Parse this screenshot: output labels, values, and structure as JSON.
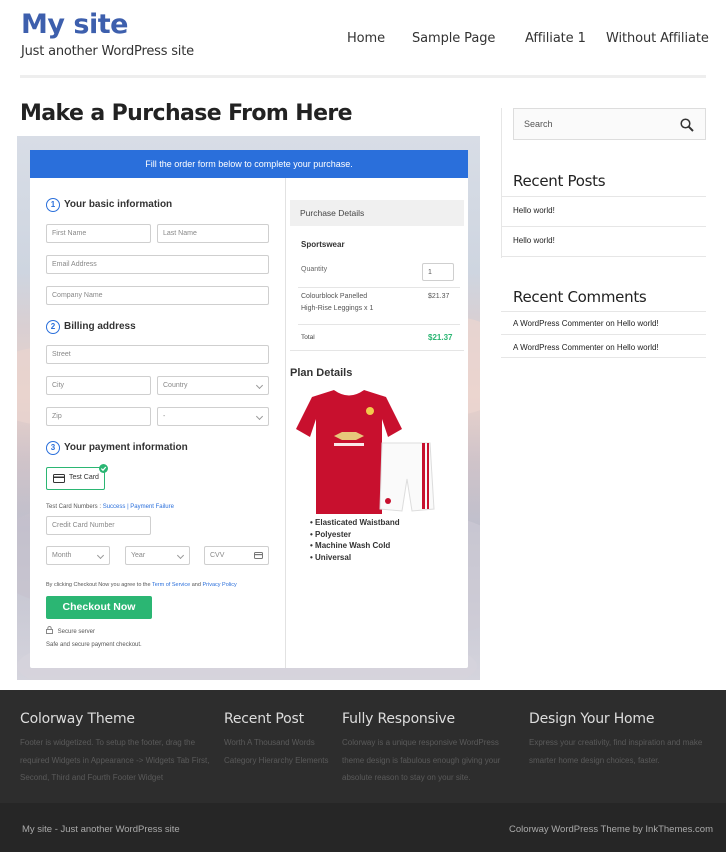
{
  "header": {
    "site_title": "My site",
    "tagline": "Just another WordPress site",
    "nav": [
      "Home",
      "Sample Page",
      "Affiliate 1",
      "Without Affiliate"
    ]
  },
  "page": {
    "title": "Make a Purchase From Here"
  },
  "form": {
    "banner": "Fill the order form below to complete your purchase.",
    "step1": {
      "num": "1",
      "title": "Your basic information"
    },
    "step2": {
      "num": "2",
      "title": "Billing address"
    },
    "step3": {
      "num": "3",
      "title": "Your payment information"
    },
    "first_name": "First Name",
    "last_name": "Last Name",
    "email": "Email Address",
    "company": "Company Name",
    "street": "Street",
    "city": "City",
    "country": "Country",
    "zip": "Zip",
    "state": "-",
    "test_card_label": "Test Card",
    "test_numbers_label": "Test Card Numbers :",
    "success": "Success",
    "sep": "|",
    "failure": "Payment Failure",
    "card_number": "Credit Card Number",
    "month": "Month",
    "year": "Year",
    "cvv": "CVV",
    "agree_prefix": "By clicking Checkout Now you agree to the",
    "terms": "Term of Service",
    "and": "and",
    "privacy": "Privacy Policy",
    "checkout": "Checkout Now",
    "secure": "Secure server",
    "safe": "Safe and secure payment checkout."
  },
  "purchase": {
    "heading": "Purchase Details",
    "product": "Sportswear",
    "quantity_label": "Quantity",
    "quantity": "1",
    "item_line1": "Colourblock Panelled",
    "item_line2": "High-Rise Leggings x 1",
    "item_price": "$21.37",
    "total_label": "Total",
    "total": "$21.37",
    "accent": "#2bb673"
  },
  "plan": {
    "title": "Plan Details",
    "bullets": [
      "Elasticated Waistband",
      "Polyester",
      "Machine Wash Cold",
      "Universal"
    ]
  },
  "sidebar": {
    "search_placeholder": "Search",
    "recent_posts_title": "Recent Posts",
    "posts": [
      "Hello world!",
      "Hello world!"
    ],
    "recent_comments_title": "Recent Comments",
    "comments": [
      {
        "author": "A WordPress Commenter",
        "on": "on",
        "post": "Hello world!"
      },
      {
        "author": "A WordPress Commenter",
        "on": "on",
        "post": "Hello world!"
      }
    ]
  },
  "footer": {
    "cols": [
      {
        "title": "Colorway Theme",
        "text": "Footer is widgetized. To setup the footer, drag the required Widgets in Appearance -> Widgets Tab First, Second, Third and Fourth Footer Widget"
      },
      {
        "title": "Recent Post",
        "text": "Worth A Thousand Words Category Hierarchy Elements"
      },
      {
        "title": "Fully Responsive",
        "text": "Colorway is a unique responsive WordPress theme design is fabulous enough giving your absolute reason to stay on your site."
      },
      {
        "title": "Design Your Home",
        "text": "Express your creativity, find inspiration and make smarter home design choices, faster."
      }
    ],
    "bottom_left": "My site - Just another WordPress site",
    "bottom_right": "Colorway WordPress Theme by InkThemes.com"
  },
  "colors": {
    "brand": "#3d5fad",
    "banner": "#2a6fdb",
    "button": "#2bb673"
  }
}
